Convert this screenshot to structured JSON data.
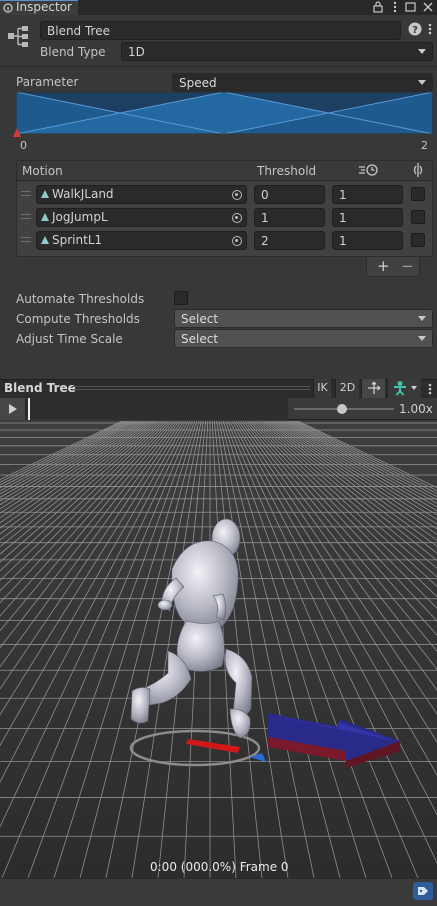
{
  "window": {
    "tab_label": "Inspector"
  },
  "header": {
    "name_value": "Blend Tree",
    "blend_type_label": "Blend Type",
    "blend_type_value": "1D"
  },
  "parameter": {
    "label": "Parameter",
    "value": "Speed",
    "range_min": "0",
    "range_max": "2"
  },
  "motion_table": {
    "col_motion": "Motion",
    "col_threshold": "Threshold",
    "rows": [
      {
        "clip": "WalkJLand",
        "threshold": "0",
        "speed": "1"
      },
      {
        "clip": "JogJumpL",
        "threshold": "1",
        "speed": "1"
      },
      {
        "clip": "SprintL1",
        "threshold": "2",
        "speed": "1"
      }
    ],
    "add_label": "+",
    "remove_label": "−"
  },
  "settings": {
    "automate_label": "Automate Thresholds",
    "compute_label": "Compute Thresholds",
    "compute_value": "Select",
    "adjust_label": "Adjust Time Scale",
    "adjust_value": "Select"
  },
  "preview": {
    "title": "Blend Tree",
    "ik_label": "IK",
    "twod_label": "2D",
    "speed_value": "1.00x",
    "status": "0:00 (000.0%) Frame 0"
  },
  "colors": {
    "accent_blue": "#2a6db5",
    "graph_fill": "#1e5a8e"
  }
}
